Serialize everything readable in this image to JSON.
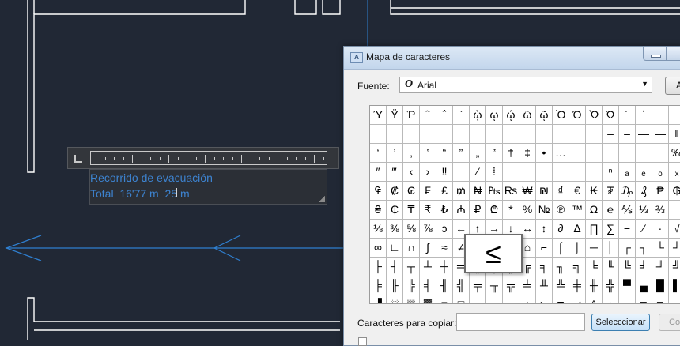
{
  "mtext_editor": {
    "line1": "Recorrido de evacuación",
    "line2": "Total  16'77 m  25 m",
    "text_color": "#3d83d0"
  },
  "colors": {
    "canvas_background": "#212835",
    "wall_lines": "#ffffff",
    "dimension_line": "#2f7fd0"
  },
  "charmap": {
    "title": "Mapa de caracteres",
    "font_label": "Fuente:",
    "font_icon": "O",
    "font_value": "Arial",
    "help_button": "A",
    "zoomed_char": "≤",
    "copy_label": "Caracteres para copiar:",
    "copy_value": "",
    "select_button": "Selecccionar",
    "copy_button": "Co",
    "grid": [
      [
        "Ύ",
        "Ϋ",
        "Ῥ",
        "῭",
        "΅",
        "`",
        "ῲ",
        "ῳ",
        "ῴ",
        "ῶ",
        "ῷ",
        "Ὸ",
        "Ό",
        "Ὼ",
        "Ώ",
        "´",
        "῾",
        "",
        ""
      ],
      [
        "",
        "",
        "",
        "",
        "",
        "",
        "",
        "",
        "",
        "",
        "",
        "",
        "",
        "",
        "‒",
        "–",
        "—",
        "―",
        "‖"
      ],
      [
        "‘",
        "’",
        "‚",
        "‛",
        "“",
        "”",
        "„",
        "‟",
        "†",
        "‡",
        "•",
        "…",
        "",
        "",
        "",
        "",
        "",
        "",
        "‰"
      ],
      [
        "″",
        "‴",
        "‹",
        "›",
        "‼",
        "‾",
        "⁄",
        "⁞",
        "",
        "",
        "",
        "",
        "",
        "",
        "ⁿ",
        "ₐ",
        "ₑ",
        "ₒ",
        "ₓ"
      ],
      [
        "₠",
        "₡",
        "₢",
        "₣",
        "₤",
        "₥",
        "₦",
        "₧",
        "₨",
        "₩",
        "₪",
        "₫",
        "€",
        "₭",
        "₮",
        "₯",
        "₰",
        "₱",
        "₲"
      ],
      [
        "₴",
        "₵",
        "₸",
        "₹",
        "₺",
        "₼",
        "₽",
        "₾",
        "*",
        "%",
        "№",
        "℗",
        "™",
        "Ω",
        "℮",
        "⅍",
        "⅓",
        "⅔",
        ""
      ],
      [
        "⅛",
        "⅜",
        "⅝",
        "⅞",
        "ↄ",
        "←",
        "↑",
        "→",
        "↓",
        "↔",
        "↕",
        "∂",
        "∆",
        "∏",
        "∑",
        "−",
        "∕",
        "∙",
        "√"
      ],
      [
        "∞",
        "∟",
        "∩",
        "∫",
        "≈",
        "≠",
        "≡",
        "≤",
        "≥",
        "⌂",
        "⌐",
        "⌠",
        "⌡",
        "─",
        "│",
        "┌",
        "┐",
        "└",
        "┘"
      ],
      [
        "├",
        "┤",
        "┬",
        "┴",
        "┼",
        "═",
        "║",
        "╒",
        "╓",
        "╔",
        "╕",
        "╖",
        "╗",
        "╘",
        "╙",
        "╚",
        "╛",
        "╜",
        "╝"
      ],
      [
        "╞",
        "╟",
        "╠",
        "╡",
        "╢",
        "╣",
        "╤",
        "╥",
        "╦",
        "╧",
        "╨",
        "╩",
        "╪",
        "╫",
        "╬",
        "▀",
        "▄",
        "█",
        "▌"
      ],
      [
        "▐",
        "░",
        "▒",
        "▓",
        "■",
        "□",
        "▪",
        "▫",
        "▬",
        "▲",
        "►",
        "▼",
        "◄",
        "◊",
        "○",
        "●",
        "◘",
        "◙",
        "◦"
      ]
    ]
  }
}
